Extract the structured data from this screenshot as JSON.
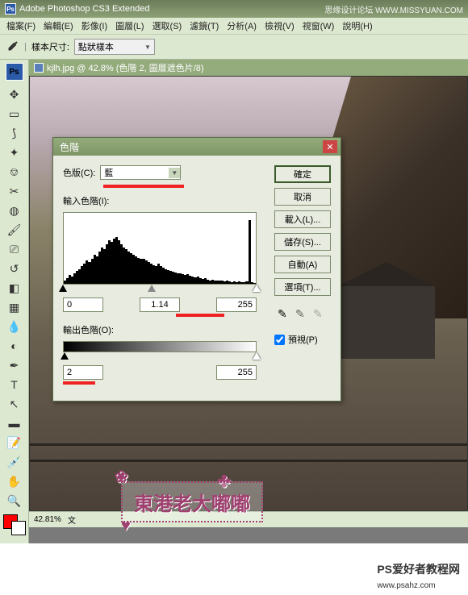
{
  "app": {
    "title": "Adobe Photoshop CS3 Extended",
    "watermark": "思缘设计论坛 WWW.MISSYUAN.COM"
  },
  "menu": [
    "檔案(F)",
    "編輯(E)",
    "影像(I)",
    "圖層(L)",
    "選取(S)",
    "濾鏡(T)",
    "分析(A)",
    "檢視(V)",
    "視窗(W)",
    "說明(H)"
  ],
  "options": {
    "sample_label": "樣本尺寸:",
    "sample_value": "點狀樣本"
  },
  "document": {
    "title": "kjlh.jpg @ 42.8% (色階 2, 圖層遮色片/8)",
    "zoom": "42.81%",
    "status": "文"
  },
  "dialog": {
    "title": "色階",
    "channel_label": "色版(C):",
    "channel_value": "藍",
    "input_label": "輸入色階(I):",
    "input_black": "0",
    "input_mid": "1.14",
    "input_white": "255",
    "output_label": "輸出色階(O):",
    "output_black": "2",
    "output_white": "255",
    "btn_ok": "確定",
    "btn_cancel": "取消",
    "btn_load": "載入(L)...",
    "btn_save": "儲存(S)...",
    "btn_auto": "自動(A)",
    "btn_options": "選項(T)...",
    "preview_label": "預視(P)",
    "preview_checked": true
  },
  "decoration": {
    "text": "東港老大嘟嘟"
  },
  "footer": {
    "site": "PS爱好者教程网",
    "url": "www.psahz.com"
  },
  "histogram": [
    5,
    8,
    12,
    10,
    15,
    18,
    20,
    25,
    28,
    32,
    30,
    35,
    40,
    38,
    45,
    50,
    48,
    55,
    60,
    58,
    62,
    65,
    60,
    55,
    50,
    48,
    45,
    42,
    40,
    38,
    36,
    35,
    34,
    32,
    30,
    28,
    26,
    25,
    28,
    24,
    22,
    20,
    19,
    18,
    17,
    16,
    15,
    14,
    13,
    12,
    13,
    11,
    10,
    9,
    10,
    8,
    7,
    8,
    6,
    5,
    6,
    5,
    4,
    5,
    4,
    3,
    4,
    3,
    2,
    3,
    2,
    3,
    2,
    2,
    3,
    88,
    2,
    1
  ]
}
